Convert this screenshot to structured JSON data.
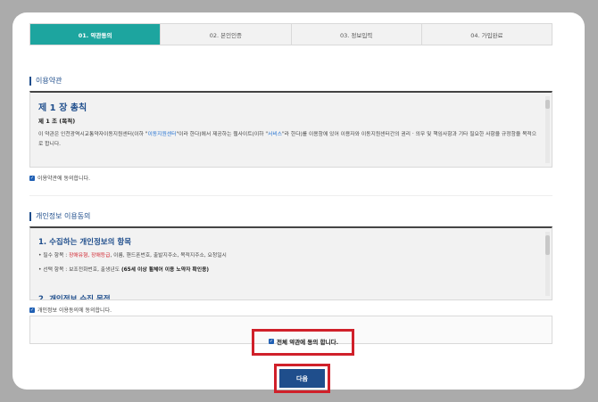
{
  "steps": {
    "s1": "01. 약관동의",
    "s2": "02. 본인인증",
    "s3": "03. 정보입력",
    "s4": "04. 가입완료"
  },
  "terms": {
    "title": "이용약관",
    "chapter": "제 1 장 총칙",
    "article": "제 1 조 (목적)",
    "body_pre": "이 약관은 인천광역시교통약자이동지원센터(이하 \"",
    "body_hl1": "이동지원센터",
    "body_mid": "\"이라 한다)에서 제공하는 웹사이트(이하 \"",
    "body_hl2": "서비스",
    "body_post": "\"라 한다)를 이용함에 있어 이용자와 이동지원센터간의 권리 · 의무 및 책임사항과 기타 필요한 사항을 규정함을 목적으로 합니다.",
    "agree": "이용약관에 동의합니다."
  },
  "privacy": {
    "title": "개인정보 이용동의",
    "heading1": "1. 수집하는 개인정보의 항목",
    "required_pre": "필수 항목 : ",
    "required_hl": "장애유형, 장애등급",
    "required_post": ", 이름, 핸드폰번호, 출발지주소, 목적지주소, 요청일시",
    "optional_pre": "선택 항목 : 보조전화번호, 출생년도 ",
    "optional_bold": "(65세 이상 휠체어 이용 노약자 확인용)",
    "heading2": "2. 개인정보 수집 목적",
    "agree": "개인정보 이용동의에 동의합니다."
  },
  "all_agree": "전체 약관에 동의 합니다.",
  "next_button": "다음",
  "check_glyph": "✓",
  "colors": {
    "step_active": "#1da59f",
    "accent": "#1f4e8c",
    "highlight": "#d0202a"
  }
}
